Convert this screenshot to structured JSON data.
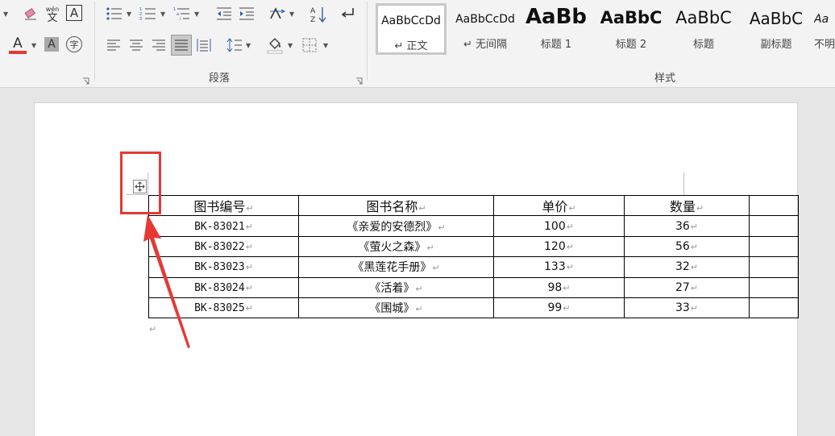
{
  "ribbon": {
    "paragraph_group_label": "段落",
    "styles_group_label": "样式",
    "font_tools": {
      "phonetic_top": "wén",
      "phonetic_bottom": "文",
      "char_border": "A",
      "font_color_letter": "A",
      "shading_letter": "A",
      "enclose_char": "字",
      "font_color": "#e53935"
    },
    "styles": [
      {
        "preview": "AaBbCcDd",
        "name": "↵ 正文",
        "active": true
      },
      {
        "preview": "AaBbCcDd",
        "name": "↵ 无间隔",
        "active": false
      },
      {
        "preview": "AaBb",
        "name": "标题 1",
        "active": false
      },
      {
        "preview": "AaBbC",
        "name": "标题 2",
        "active": false
      },
      {
        "preview": "AaBbC",
        "name": "标题",
        "active": false
      },
      {
        "preview": "AaBbC",
        "name": "副标题",
        "active": false
      },
      {
        "preview": "Aa",
        "name": "不明",
        "active": false
      }
    ]
  },
  "table": {
    "headers": [
      "图书编号",
      "图书名称",
      "单价",
      "数量",
      ""
    ],
    "rows": [
      [
        "BK-83021",
        "《亲爱的安德烈》",
        "100",
        "36",
        ""
      ],
      [
        "BK-83022",
        "《萤火之森》",
        "120",
        "56",
        ""
      ],
      [
        "BK-83023",
        "《黑莲花手册》",
        "133",
        "32",
        ""
      ],
      [
        "BK-83024",
        "《活着》",
        "98",
        "27",
        ""
      ],
      [
        "BK-83025",
        "《围城》",
        "99",
        "33",
        ""
      ]
    ],
    "mark": "↵"
  },
  "document": {
    "end_mark": "↵"
  },
  "colors": {
    "highlight": "#e53935",
    "ribbon_bg": "#f3f3f3",
    "doc_bg": "#e6e6e6"
  },
  "icons": [
    "eraser-icon",
    "bullets-icon",
    "numbering-icon",
    "multilevel-list-icon",
    "decrease-indent-icon",
    "increase-indent-icon",
    "chinese-layout-icon",
    "sort-icon",
    "show-marks-icon",
    "align-left-icon",
    "align-center-icon",
    "align-right-icon",
    "justify-icon",
    "distributed-icon",
    "line-spacing-icon",
    "shading-icon",
    "borders-icon",
    "table-move-handle-icon"
  ]
}
